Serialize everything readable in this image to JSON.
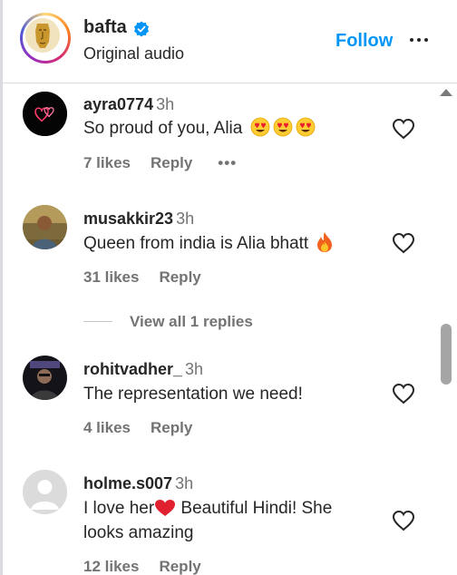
{
  "header": {
    "username": "bafta",
    "subtitle": "Original audio",
    "follow_label": "Follow",
    "verified_color": "#0095f6",
    "more_icon": "more-horizontal-icon"
  },
  "comments": [
    {
      "username": "ayra0774",
      "time": "3h",
      "text": "So proud of you, Alia",
      "emojis": [
        "heart-eyes",
        "heart-eyes",
        "heart-eyes"
      ],
      "likes": "7 likes",
      "reply": "Reply",
      "has_more": true
    },
    {
      "username": "musakkir23",
      "time": "3h",
      "text": "Queen from india is Alia bhatt",
      "emojis": [
        "fire"
      ],
      "likes": "31 likes",
      "reply": "Reply"
    },
    {
      "username": "rohitvadher_",
      "time": "3h",
      "text": "The representation we need!",
      "likes": "4 likes",
      "reply": "Reply"
    },
    {
      "username": "holme.s007",
      "time": "3h",
      "text_before": "I love her",
      "text_after": " Beautiful Hindi! She looks amazing",
      "emojis": [
        "red-heart"
      ],
      "likes": "12 likes",
      "reply": "Reply"
    }
  ],
  "view_replies": "View all 1 replies",
  "colors": {
    "accent": "#0095f6",
    "muted": "#737373",
    "text": "#262626"
  }
}
